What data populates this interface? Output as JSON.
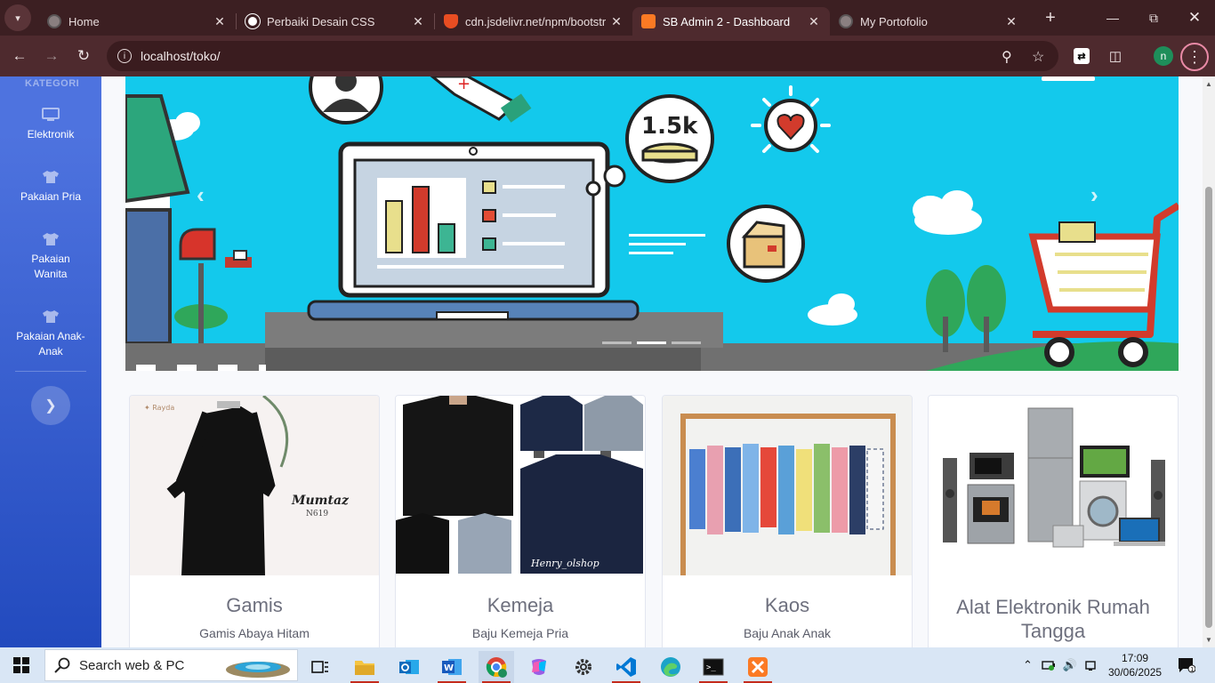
{
  "browser": {
    "tabs": [
      {
        "label": "Home",
        "icon": "globe-icon",
        "active": false
      },
      {
        "label": "Perbaiki Desain CSS",
        "icon": "openai-icon",
        "active": false
      },
      {
        "label": "cdn.jsdelivr.net/npm/bootstr",
        "icon": "shield-icon",
        "active": false
      },
      {
        "label": "SB Admin 2 - Dashboard",
        "icon": "xampp-icon",
        "active": true
      },
      {
        "label": "My Portofolio",
        "icon": "globe-icon",
        "active": false
      }
    ],
    "url": "localhost/toko/",
    "profile_initial": "n"
  },
  "sidebar": {
    "heading": "KATEGORI",
    "items": [
      {
        "label": "Elektronik",
        "icon": "desktop-icon"
      },
      {
        "label": "Pakaian Pria",
        "icon": "tshirt-icon"
      },
      {
        "label": "Pakaian Wanita",
        "icon": "tshirt-icon"
      },
      {
        "label": "Pakaian Anak-Anak",
        "icon": "tshirt-icon"
      }
    ],
    "toggle_icon": "chevron-right-icon"
  },
  "carousel": {
    "banner_badge": "1.5k",
    "slide_count": 3,
    "active_slide": 2
  },
  "products": [
    {
      "title": "Gamis",
      "text": "Gamis Abaya Hitam",
      "image_caption": "Mumtaz",
      "image_sub": "N619"
    },
    {
      "title": "Kemeja",
      "text": "Baju Kemeja Pria",
      "image_caption": "Henry_olshop"
    },
    {
      "title": "Kaos",
      "text": "Baju Anak Anak"
    },
    {
      "title": "Alat Elektronik Rumah Tangga",
      "text": ""
    }
  ],
  "taskbar": {
    "search_placeholder": "Search web & PC",
    "time": "17:09",
    "date": "30/06/2025"
  },
  "colors": {
    "sidebar_top": "#4e73df",
    "sidebar_bottom": "#224abe",
    "banner_bg": "#13c9ec",
    "chrome_bg": "#3c1f22"
  }
}
